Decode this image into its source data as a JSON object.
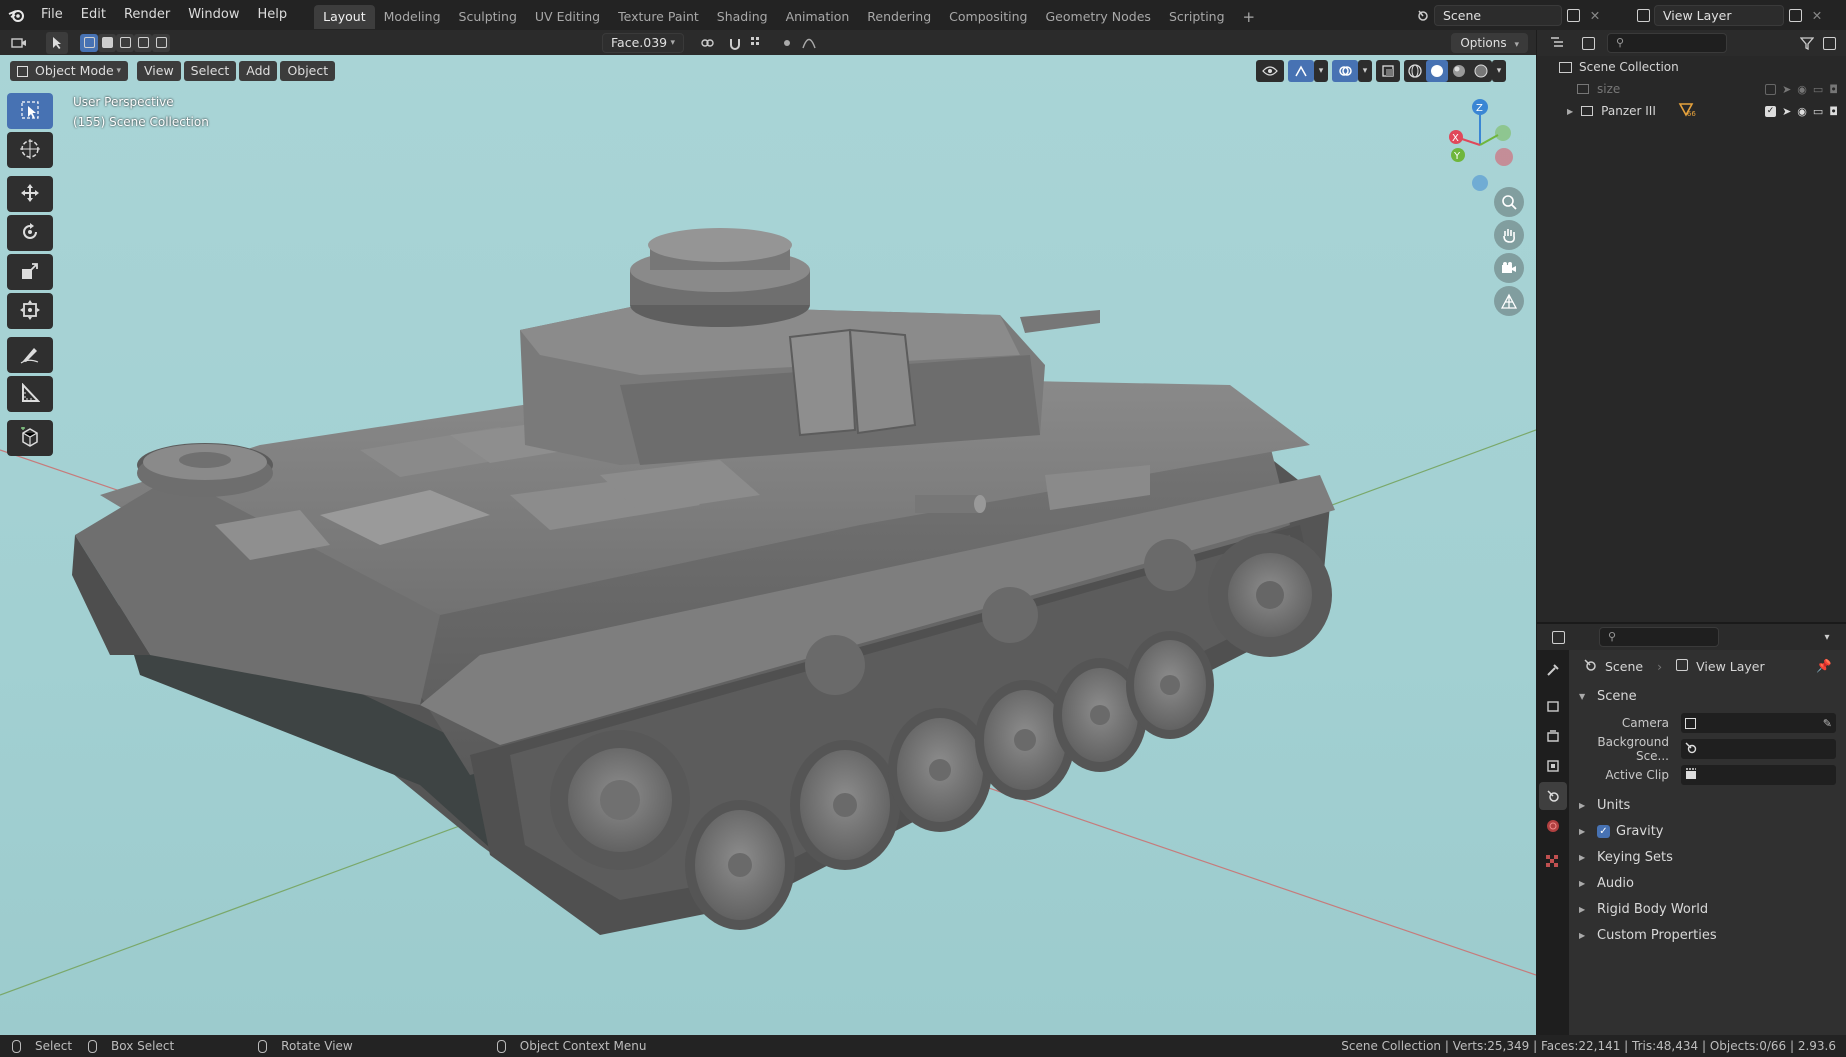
{
  "menubar": {
    "items": [
      "File",
      "Edit",
      "Render",
      "Window",
      "Help"
    ],
    "workspaces": [
      "Layout",
      "Modeling",
      "Sculpting",
      "UV Editing",
      "Texture Paint",
      "Shading",
      "Animation",
      "Rendering",
      "Compositing",
      "Geometry Nodes",
      "Scripting"
    ],
    "active_workspace": "Layout",
    "add_tab": "+",
    "scene": "Scene",
    "view_layer": "View Layer"
  },
  "tool_header": {
    "active_object": "Face.039",
    "options": "Options"
  },
  "viewport_header": {
    "mode": "Object Mode",
    "menus": [
      "View",
      "Select",
      "Add",
      "Object"
    ]
  },
  "viewport": {
    "view_name": "User Perspective",
    "collection_info": "(155) Scene Collection",
    "background_color": "#a6d2d4",
    "gizmo": {
      "x_label": "X",
      "y_label": "Y",
      "z_label": "Z",
      "x_color": "#e0485a",
      "y_color": "#6fb63b",
      "z_color": "#3a86d4"
    }
  },
  "toolbar": {
    "tools": [
      "select-box-icon",
      "cursor-icon",
      "move-icon",
      "rotate-icon",
      "scale-icon",
      "transform-icon",
      "annotate-icon",
      "measure-icon",
      "add-cube-icon"
    ]
  },
  "outliner": {
    "root": "Scene Collection",
    "items": [
      {
        "name": "size",
        "dimmed": true
      },
      {
        "name": "Panzer III",
        "dimmed": false,
        "badge": "66"
      }
    ]
  },
  "properties": {
    "breadcrumb": [
      "Scene",
      "View Layer"
    ],
    "panel_title": "Scene",
    "fields": [
      {
        "label": "Camera"
      },
      {
        "label": "Background Sce..."
      },
      {
        "label": "Active Clip"
      }
    ],
    "subpanels": [
      {
        "label": "Units",
        "checkbox": false
      },
      {
        "label": "Gravity",
        "checkbox": true
      },
      {
        "label": "Keying Sets",
        "checkbox": false
      },
      {
        "label": "Audio",
        "checkbox": false
      },
      {
        "label": "Rigid Body World",
        "checkbox": false
      },
      {
        "label": "Custom Properties",
        "checkbox": false
      }
    ]
  },
  "statusbar": {
    "select": "Select",
    "box_select": "Box Select",
    "rotate_view": "Rotate View",
    "context_menu": "Object Context Menu",
    "stats": "Scene Collection | Verts:25,349 | Faces:22,141 | Tris:48,434 | Objects:0/66 | 2.93.6"
  },
  "colors": {
    "accent": "#4772b3",
    "tank_body": "#6b6b6b"
  }
}
